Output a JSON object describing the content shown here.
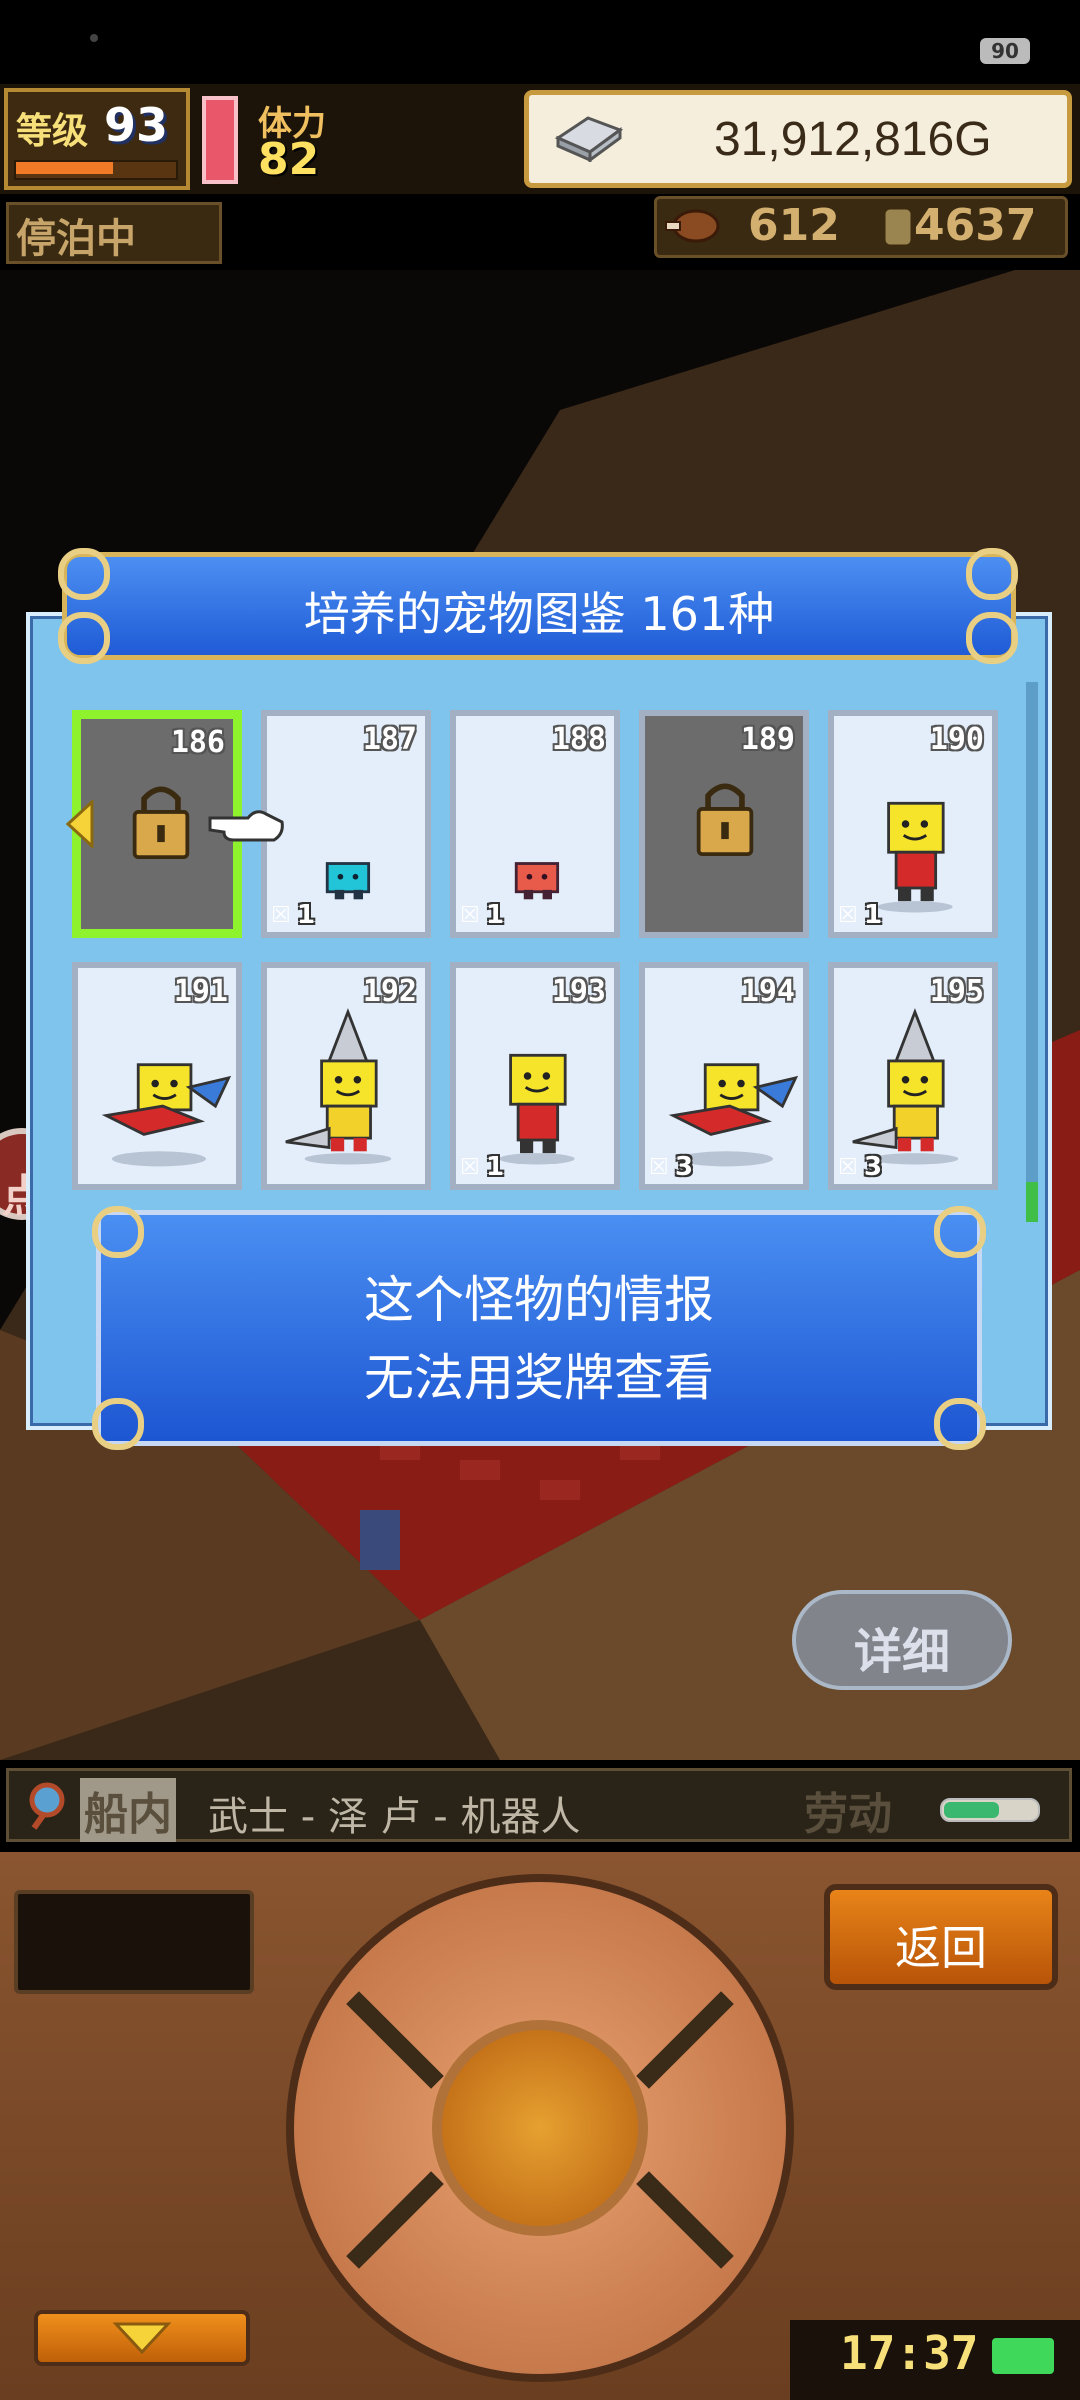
{
  "status_bar": {
    "battery": "90"
  },
  "hud": {
    "level_label": "等级",
    "level_value": "93",
    "exp_fraction": 0.62,
    "stamina_label": "体力",
    "stamina_value": "82",
    "gold": "31,912,816G",
    "dock_status": "停泊中",
    "food_value": "612",
    "medal_value": "4637"
  },
  "side_button": {
    "label": "点"
  },
  "encyclopedia": {
    "title": "培养的宠物图鉴  161种",
    "cards": [
      {
        "number": "186",
        "locked": true,
        "selected": true,
        "sprite": "lock-icon",
        "count": ""
      },
      {
        "number": "187",
        "locked": false,
        "sprite": "cyan-robot",
        "count": "1"
      },
      {
        "number": "188",
        "locked": false,
        "sprite": "red-robot",
        "count": "1"
      },
      {
        "number": "189",
        "locked": true,
        "sprite": "lock-icon",
        "count": ""
      },
      {
        "number": "190",
        "locked": false,
        "sprite": "yellow-robot",
        "count": "1"
      },
      {
        "number": "191",
        "locked": false,
        "sprite": "flying-robot",
        "count": ""
      },
      {
        "number": "192",
        "locked": false,
        "sprite": "drill-robot",
        "count": ""
      },
      {
        "number": "193",
        "locked": false,
        "sprite": "yellow-robot",
        "count": "1"
      },
      {
        "number": "194",
        "locked": false,
        "sprite": "flying-robot",
        "count": "3"
      },
      {
        "number": "195",
        "locked": false,
        "sprite": "drill-robot",
        "count": "3"
      }
    ],
    "info_line1": "这个怪物的情报",
    "info_line2": "无法用奖牌查看"
  },
  "detail_button": {
    "label": "详细"
  },
  "location_bar": {
    "location_label": "船内",
    "path": "武士 - 泽 卢 - 机器人",
    "job_label": "劳动",
    "job_fraction": 0.6
  },
  "controls": {
    "back_label": "返回",
    "clock": "17:37"
  },
  "colors": {
    "panel_bg": "#7fc4ec",
    "title_bar": "#1f5bd6",
    "selected_border": "#8ef22c",
    "locked_card": "#6c6c6c",
    "unlocked_card": "#e3eefa"
  }
}
